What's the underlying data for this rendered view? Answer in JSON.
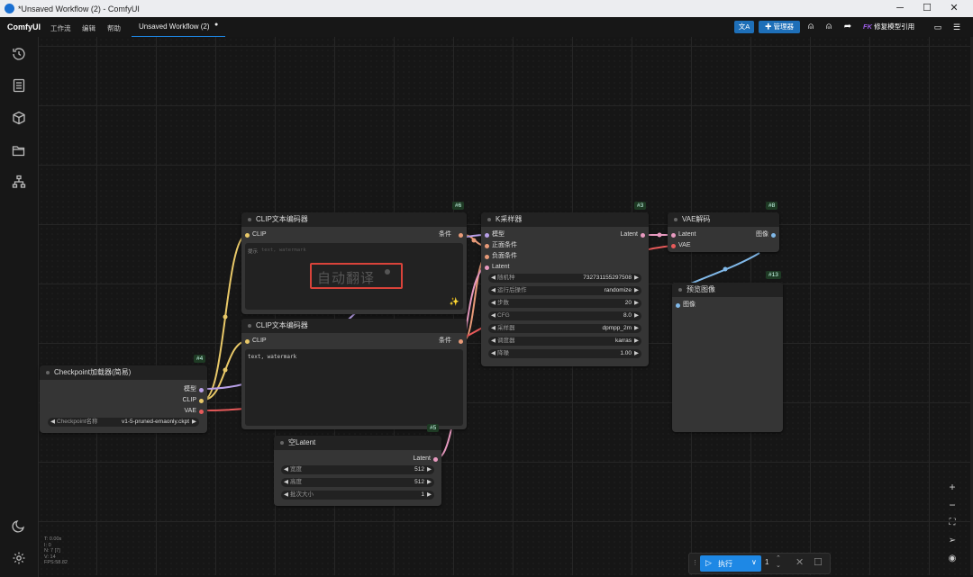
{
  "window": {
    "title": "*Unsaved Workflow (2) - ComfyUI",
    "minimize": "─",
    "maximize": "☐",
    "close": "✕"
  },
  "menubar": {
    "brand": "ComfyUI",
    "menus": [
      "工作流",
      "编辑",
      "帮助"
    ],
    "tab_label": "Unsaved Workflow (2)",
    "tab_modified": "●",
    "translate_icon": "文A",
    "manager_label": "管理器",
    "model_ref_prefix": "FK",
    "model_ref_label": "修复模型引用"
  },
  "nodes": {
    "clip6": {
      "title": "CLIP文本编码器",
      "id": "#6",
      "input": "CLIP",
      "output": "条件",
      "placeholder": "text, watermark",
      "textarea_hint": "提示",
      "overlay_text": "自动翻译"
    },
    "clip7": {
      "title": "CLIP文本编码器",
      "input": "CLIP",
      "output": "条件",
      "text": "text, watermark"
    },
    "ksampler": {
      "title": "K采样器",
      "id": "#3",
      "inputs": [
        "模型",
        "正面条件",
        "负面条件",
        "Latent"
      ],
      "output": "Latent",
      "widgets": [
        {
          "label": "随机种",
          "value": "732731155297508"
        },
        {
          "label": "运行后操作",
          "value": "randomize"
        },
        {
          "label": "步数",
          "value": "20"
        },
        {
          "label": "CFG",
          "value": "8.0"
        },
        {
          "label": "采样器",
          "value": "dpmpp_2m"
        },
        {
          "label": "调度器",
          "value": "karras"
        },
        {
          "label": "降噪",
          "value": "1.00"
        }
      ]
    },
    "vaedecode": {
      "title": "VAE解码",
      "id": "#8",
      "inputs": [
        "Latent",
        "VAE"
      ],
      "output": "图像"
    },
    "preview": {
      "title": "预览图像",
      "id": "#13",
      "input": "图像"
    },
    "checkpoint": {
      "title": "Checkpoint加载器(简易)",
      "id": "#4",
      "outputs": [
        "模型",
        "CLIP",
        "VAE"
      ],
      "widget_label": "Checkpoint名称",
      "widget_value": "v1-5-pruned-emaonly.ckpt"
    },
    "latent": {
      "title": "空Latent",
      "id": "#5",
      "output": "Latent",
      "widgets": [
        {
          "label": "宽度",
          "value": "512"
        },
        {
          "label": "高度",
          "value": "512"
        },
        {
          "label": "批次大小",
          "value": "1"
        }
      ]
    }
  },
  "stats": [
    "T: 0.00s",
    "I: 0",
    "N: 7 [7]",
    "V: 14",
    "FPS:58.82"
  ],
  "queue": {
    "run_label": "执行",
    "batch_count": "1"
  },
  "colors": {
    "accent": "#1e88e5",
    "clip_wire": "#e8c868",
    "cond_wire": "#e89a78",
    "latent_wire": "#e89ac0",
    "vae_wire": "#e85a5a",
    "model_wire": "#b8a0e8",
    "image_wire": "#80b8e8"
  }
}
